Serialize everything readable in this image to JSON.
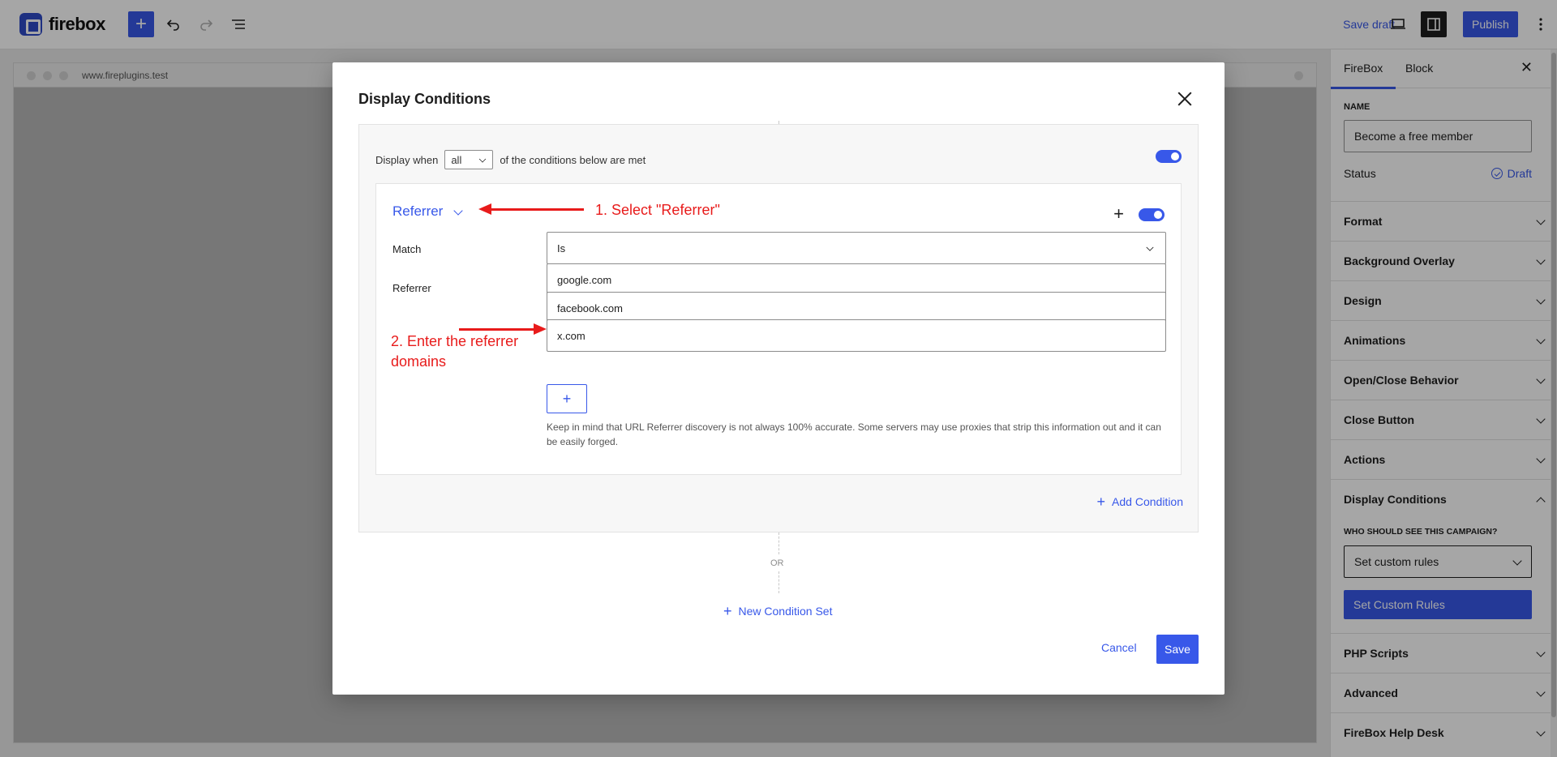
{
  "app": {
    "logo_text": "firebox"
  },
  "toolbar": {
    "add_icon": "plus-icon",
    "undo_icon": "undo-icon",
    "redo_icon": "redo-icon",
    "outline_icon": "list-view-icon",
    "save_draft": "Save draft",
    "view_icon": "desktop-view-icon",
    "sidebar_icon": "sidebar-toggle-icon",
    "publish": "Publish",
    "more_icon": "more-vertical-icon",
    "accent": "#3858e9"
  },
  "browser": {
    "url": "www.fireplugins.test"
  },
  "sidebar": {
    "tabs": [
      {
        "label": "FireBox"
      },
      {
        "label": "Block"
      }
    ],
    "name_label": "NAME",
    "name_value": "Become a free member",
    "status_label": "Status",
    "status_value": "Draft",
    "panels": [
      {
        "label": "Format"
      },
      {
        "label": "Background Overlay"
      },
      {
        "label": "Design"
      },
      {
        "label": "Animations"
      },
      {
        "label": "Open/Close Behavior"
      },
      {
        "label": "Close Button"
      },
      {
        "label": "Actions"
      },
      {
        "label": "Display Conditions"
      },
      {
        "label": "PHP Scripts"
      },
      {
        "label": "Advanced"
      },
      {
        "label": "FireBox Help Desk"
      }
    ],
    "display_conditions": {
      "question": "WHO SHOULD SEE THIS CAMPAIGN?",
      "select_value": "Set custom rules",
      "button": "Set Custom Rules"
    }
  },
  "modal": {
    "title": "Display Conditions",
    "display_when_prefix": "Display when",
    "match_all_value": "all",
    "display_when_suffix": "of the conditions below are met",
    "condition": {
      "type": "Referrer",
      "match_label": "Match",
      "match_value": "Is",
      "referrer_label": "Referrer",
      "referrers": [
        "google.com",
        "facebook.com",
        "x.com"
      ],
      "hint": "Keep in mind that URL Referrer discovery is not always 100% accurate. Some servers may use proxies that strip this information out and it can be easily forged."
    },
    "add_condition": "Add Condition",
    "or_label": "OR",
    "new_condition_set": "New Condition Set",
    "cancel": "Cancel",
    "save": "Save"
  },
  "annotations": {
    "step1": "1. Select \"Referrer\"",
    "step2_line1": "2. Enter the referrer",
    "step2_line2": "domains",
    "color": "#e81b1b"
  }
}
